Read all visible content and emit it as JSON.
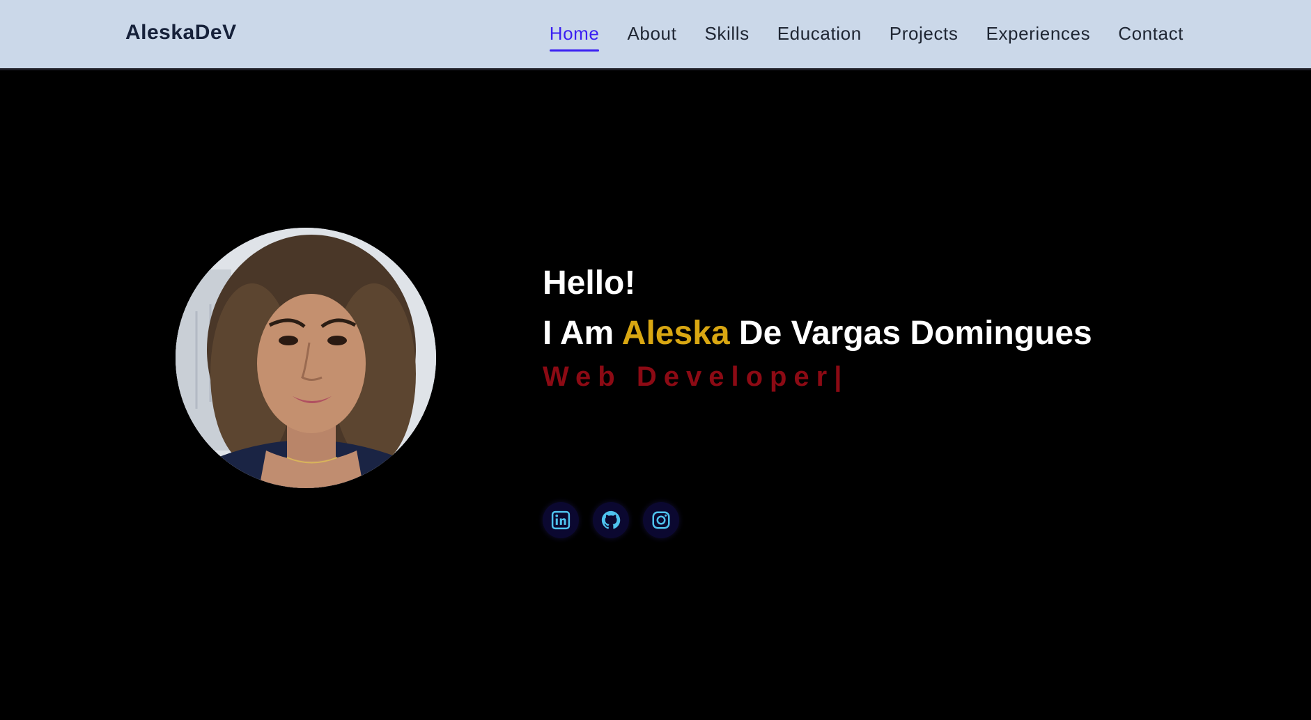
{
  "nav": {
    "brand": "AleskaDeV",
    "links": [
      {
        "label": "Home",
        "active": true
      },
      {
        "label": "About"
      },
      {
        "label": "Skills"
      },
      {
        "label": "Education"
      },
      {
        "label": "Projects"
      },
      {
        "label": "Experiences"
      },
      {
        "label": "Contact"
      }
    ]
  },
  "hero": {
    "greeting": "Hello!",
    "intro_prefix": "I Am ",
    "first_name": "Aleska",
    "last_name": " De Vargas Domingues",
    "role": "Web Developer",
    "cursor": "|"
  },
  "social": [
    {
      "icon": "linkedin-icon"
    },
    {
      "icon": "github-icon"
    },
    {
      "icon": "instagram-icon"
    }
  ],
  "colors": {
    "nav_background": "#cbd8e9",
    "nav_text": "#1f2633",
    "active_link": "#3a1ff2",
    "page_background": "#000000",
    "name_highlight": "#d9a712",
    "role_text": "#8c0a14",
    "social_icon": "#4fc3ee"
  }
}
